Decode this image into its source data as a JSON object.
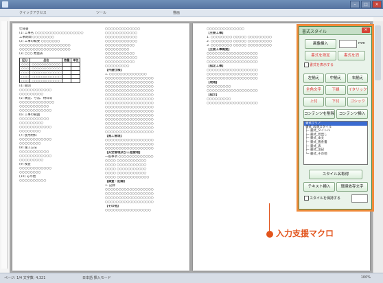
{
  "titlebar": {
    "title": "",
    "min": "–",
    "max": "□",
    "close": "×"
  },
  "ribbon": {
    "tabs": [
      "クイックアクセス",
      "ツール",
      "描画",
      "",
      "",
      ""
    ]
  },
  "left_page": {
    "col1": [
      "",
      "仕様書",
      "(1) 工事名 ○○○○○○○○○○○○○○○○○○",
      "工事期間 ○○○○○○○○",
      "(2) 工事の概要 ○○○○○○○",
      "○○○○○○○○○○○○○○○○○○○",
      "○○○○○○○○○○○○○○○○○○○",
      "",
      "(3) ○○○ 数量表",
      "",
      "",
      "",
      "",
      "",
      "",
      "(4) 総則",
      "○○○○○○○○○○○○",
      "○○○○○○○○○",
      "",
      "(5) 構造、寸法、材料等",
      "○○○○○○○○○○○○○",
      "○○○○○○○○○○○",
      "○○○○○○○○○○○○",
      "",
      "(6) 工事の範囲",
      "○○○○○○○○○○○",
      "○○○○○○○○○",
      "○○○○○○○○○○○○",
      "○○○○○○○○",
      "",
      "(7) 使用材料",
      "○○○○○○○○○○○○",
      "○○○○○○○○",
      "",
      "(8) 施工方法",
      "○○○○○○○○○○○",
      "○○○○○○○○○○○○",
      "○○○○○○○○○",
      "",
      "(9) 検査",
      "○○○○○○○○○○○○",
      "○○○○○○○○",
      "",
      "(10) その他",
      "○○○○○○○○○○"
    ],
    "table": {
      "head": [
        "区分",
        "品名",
        "数量",
        "単位"
      ],
      "rows": [
        [
          "○○○",
          "○○○○○○○○○○○○",
          "",
          ""
        ],
        [
          "○○○",
          "○○○○○○○○○○○○",
          "",
          ""
        ],
        [
          "○○○",
          "○○○○○○○○○○○○",
          "",
          ""
        ],
        [
          "○○○",
          "○○○○○○○○○○○○",
          "",
          ""
        ],
        [
          "○○○",
          "○○○○○○○○○○○○",
          "",
          ""
        ]
      ]
    },
    "col2": [
      "○○○○○○○○○○○○○",
      "○○○○○○○○○○○○",
      "○○○○○○○○○○○○",
      "○○○○○○○○○○○○",
      "○○○○○○○○○○○",
      "",
      "○○○○○○○○○",
      "○○○○○○○○○○○",
      "○○○○○○○○○○○○",
      "○○○○○○○○○○○",
      "○○○○○○○○○",
      "",
      "【共通仕様】",
      "1. ○○○○○○○○○○○○○○",
      "○○○○○○○○○○○○○○○○○○",
      "○○○○○○○○○○○○○○○○○○",
      "○○○○○○○○○○○○○○○○○○",
      "○○○○○○○○○○○○○○○○○○",
      "○○○○○○○○○○○○○○○○○○",
      "○○○○○○○○○○○○○○○○○○",
      "○○○○○○○○○○○○○○○○○○",
      "○○○○○○○○○○○○○○○○○○",
      "○○○○○○○○○○○○○○○○○○",
      "○○○○○○○○○○○○○○○○○○",
      "○○○○○○○○○○○○○○○○○○",
      "○○○○○○○○○○○○○○○○○○",
      "○○○○○○○○○○○○○○○○○○",
      "○○○○○○○○○○○○○○○○○○",
      "",
      "【施工管理】",
      "○○○○○○○○○○○○○○○○○○",
      "○○○○○○○○○○○○○○○○○○",
      "○○○○○○○○○○○○○○○○○○",
      "",
      "【安全管理及び工程管理】",
      "一般事項 ○○○○○○○○○○○○○",
      "○○○○ ○○○○○○○○○○○",
      "○○○○ ○○○○○○○○○○○",
      "○○○○ ○○○○○○○○○○○",
      "○○○○ ○○○○○○○○○○○",
      "",
      "",
      "○○○○ ○○○○○○○○○○○○",
      "",
      "【調査・記録】",
      "1. 記録",
      "○○○○○○○○○○○○○○○○○○",
      "○○○○○○○○○○○○○○○○○○",
      "○○○○○○○○○○○○○○○○○○",
      "○○○○○○○○○○○○○○○○○○",
      "",
      "【その他】",
      "○○○○○○○○○○○○○○○○○"
    ]
  },
  "right_page": {
    "col1": [
      "○○○○○○○○○○○○○○",
      "",
      "【主要工事】",
      "1. ○○○○○○○○ ○○○○○ ○○○○○○○○○",
      "2. ○○○○○○○○ ○○○○○ ○○○○○○○○○",
      "3. ○○○○○○○○ ○○○○○ ○○○○○○○○○",
      "",
      "【主要工事概要】",
      "○○○○○○○○○○○○○○○○○○○",
      "○○○○○○○○○○○○○○○○○○○",
      "○○○○○○○○○○○○○○○○○○○",
      "",
      "【指定工事】",
      "○○○○○○○○○○○○○○○○○○○",
      "○○○○○○○○○○○○○○○○○○○",
      "○○○○○○○○○○○○○○○○○○○",
      "",
      "【現場】",
      "○○○○○○○○○",
      "○○○○○○○○○○○○○○○○○○○",
      "",
      "【指示】",
      "○○○○○○○○○",
      "○○○○○○○○○○○○○○○○○○○"
    ]
  },
  "panel": {
    "title": "書式スタイル",
    "close": "×",
    "btn_insert": "画像挿入",
    "unit": "mm",
    "btn_row2a": "書式を設定",
    "btn_row2b": "書式を消",
    "chk_label": "書式を表示する",
    "align": [
      "左揃え",
      "中揃え",
      "右揃え"
    ],
    "style_a": [
      "全角文字",
      "下線",
      "イタリック"
    ],
    "style_b": [
      "上付",
      "下付",
      "ゴシック"
    ],
    "cont": [
      "コンテンツを削除",
      "コンテンツ挿入"
    ],
    "list": [
      "書式クリア",
      "書式_段落スタイル",
      "├─ 書式_タイトル",
      "├─ 書式_見出し",
      "├─ 書式_本文",
      "├─ 書式_箇条書",
      "├─ 書式_表",
      "├─ 書式_注記",
      "└─ 書式_その他"
    ],
    "btn_style_get": "スタイル名取得",
    "btn_text_ins": "テキスト挿入",
    "btn_char": "環境依存文字",
    "chk2_label": "スタイルを保持する"
  },
  "callout": {
    "text": "入力支援マクロ"
  },
  "status": {
    "left": "ページ: 1/4  文字数: 4,321",
    "mid": "日本語  挿入モード",
    "right": "100%"
  },
  "colors": {
    "accent": "#e2541c",
    "panel_bg": "#e9f3ea",
    "panel_border": "#4c8a4c"
  }
}
